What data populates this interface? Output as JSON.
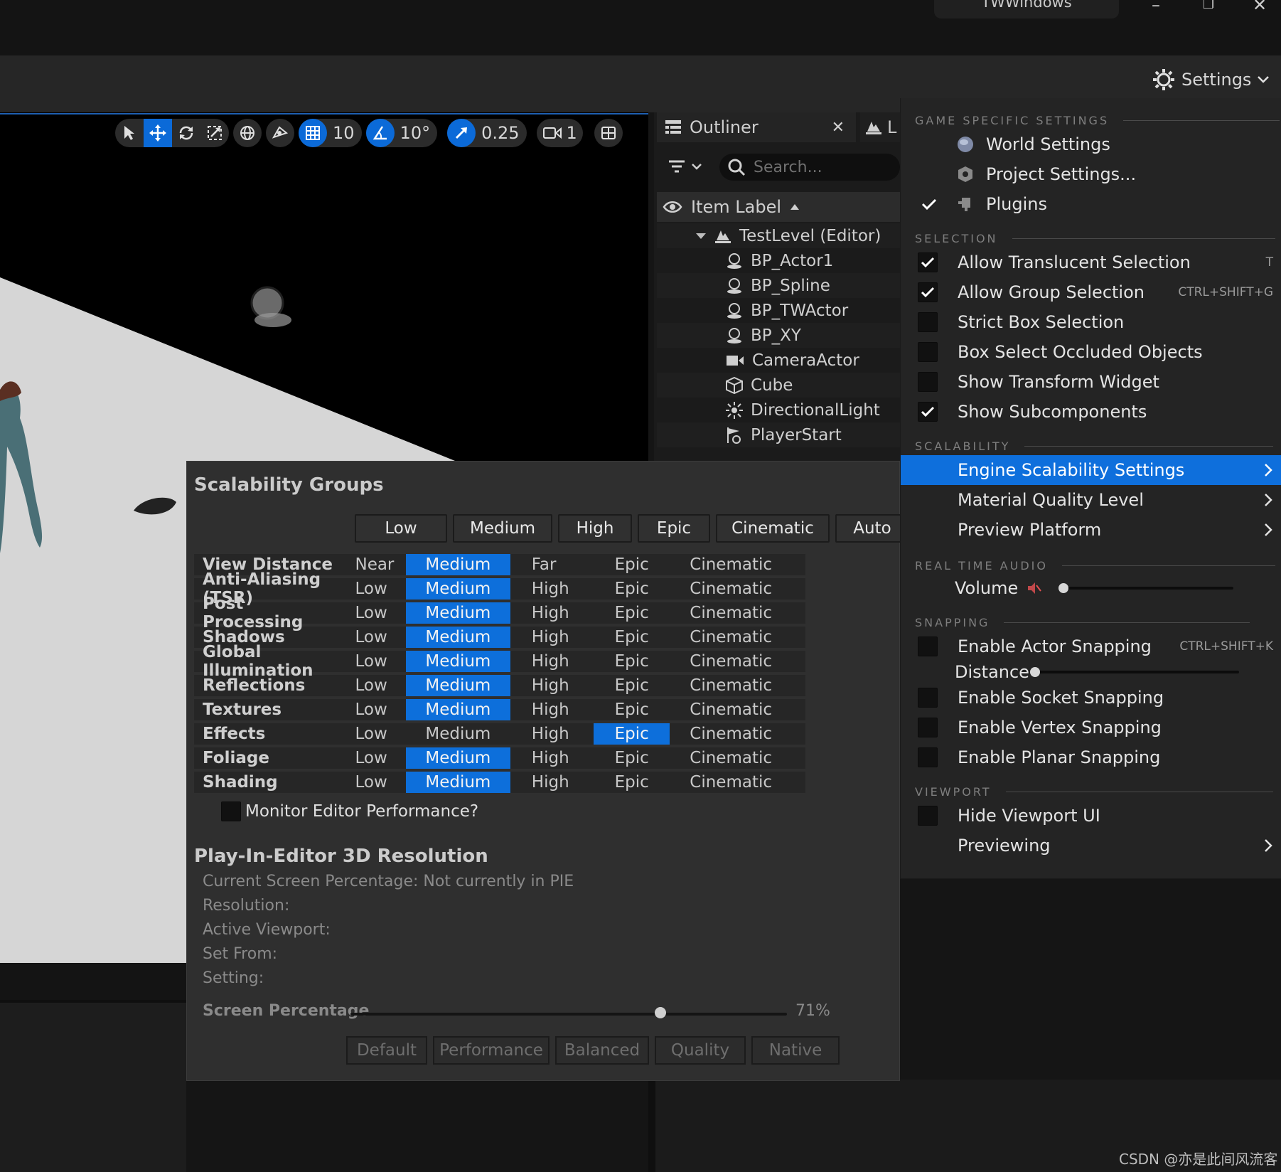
{
  "window": {
    "tab_title": "TWWindows",
    "minimize": "–",
    "restore": "❐",
    "close": "✕"
  },
  "settings_button": {
    "label": "Settings"
  },
  "viewport_toolbar": {
    "grid_snap_value": "10",
    "rotation_snap_value": "10°",
    "scale_snap_value": "0.25",
    "camera_speed_value": "1"
  },
  "outliner": {
    "tab_label": "Outliner",
    "second_tab_label": "L",
    "search_placeholder": "Search...",
    "column_header": "Item Label",
    "level": "TestLevel (Editor)",
    "items": [
      {
        "label": "BP_Actor1",
        "icon": "actor-icon"
      },
      {
        "label": "BP_Spline",
        "icon": "actor-icon"
      },
      {
        "label": "BP_TWActor",
        "icon": "actor-icon"
      },
      {
        "label": "BP_XY",
        "icon": "actor-icon"
      },
      {
        "label": "CameraActor",
        "icon": "camera-icon"
      },
      {
        "label": "Cube",
        "icon": "cube-icon"
      },
      {
        "label": "DirectionalLight",
        "icon": "sun-icon"
      },
      {
        "label": "PlayerStart",
        "icon": "flag-icon"
      }
    ]
  },
  "scalability": {
    "title": "Scalability Groups",
    "levels": [
      "Low",
      "Medium",
      "High",
      "Epic",
      "Cinematic",
      "Auto"
    ],
    "groups": [
      {
        "name": "View Distance",
        "cols": [
          "Near",
          "Medium",
          "Far",
          "Epic",
          "Cinematic"
        ],
        "selected": 1
      },
      {
        "name": "Anti-Aliasing (TSR)",
        "cols": [
          "Low",
          "Medium",
          "High",
          "Epic",
          "Cinematic"
        ],
        "selected": 1
      },
      {
        "name": "Post Processing",
        "cols": [
          "Low",
          "Medium",
          "High",
          "Epic",
          "Cinematic"
        ],
        "selected": 1
      },
      {
        "name": "Shadows",
        "cols": [
          "Low",
          "Medium",
          "High",
          "Epic",
          "Cinematic"
        ],
        "selected": 1
      },
      {
        "name": "Global Illumination",
        "cols": [
          "Low",
          "Medium",
          "High",
          "Epic",
          "Cinematic"
        ],
        "selected": 1
      },
      {
        "name": "Reflections",
        "cols": [
          "Low",
          "Medium",
          "High",
          "Epic",
          "Cinematic"
        ],
        "selected": 1
      },
      {
        "name": "Textures",
        "cols": [
          "Low",
          "Medium",
          "High",
          "Epic",
          "Cinematic"
        ],
        "selected": 1
      },
      {
        "name": "Effects",
        "cols": [
          "Low",
          "Medium",
          "High",
          "Epic",
          "Cinematic"
        ],
        "selected": 3
      },
      {
        "name": "Foliage",
        "cols": [
          "Low",
          "Medium",
          "High",
          "Epic",
          "Cinematic"
        ],
        "selected": 1
      },
      {
        "name": "Shading",
        "cols": [
          "Low",
          "Medium",
          "High",
          "Epic",
          "Cinematic"
        ],
        "selected": 1
      }
    ],
    "monitor_label": "Monitor Editor Performance?",
    "pie_title": "Play-In-Editor 3D Resolution",
    "pie_lines": [
      "Current Screen Percentage: Not currently in PIE",
      "Resolution:",
      "Active Viewport:",
      "Set From:",
      "Setting:"
    ],
    "screen_percentage_label": "Screen Percentage",
    "screen_percentage_value": "71%",
    "screen_percentage_fraction": 0.71,
    "presets": [
      "Default",
      "Performance",
      "Balanced",
      "Quality",
      "Native"
    ]
  },
  "menu": {
    "sections": {
      "game": "GAME SPECIFIC SETTINGS",
      "selection": "SELECTION",
      "scalability": "SCALABILITY",
      "audio": "REAL TIME AUDIO",
      "snapping": "SNAPPING",
      "viewport": "VIEWPORT"
    },
    "world_settings": "World Settings",
    "project_settings": "Project Settings...",
    "plugins": "Plugins",
    "allow_translucent": {
      "label": "Allow Translucent Selection",
      "shortcut": "T",
      "checked": true
    },
    "allow_group": {
      "label": "Allow Group Selection",
      "shortcut": "CTRL+SHIFT+G",
      "checked": true
    },
    "strict_box": {
      "label": "Strict Box Selection",
      "checked": false
    },
    "box_occluded": {
      "label": "Box Select Occluded Objects",
      "checked": false
    },
    "show_transform": {
      "label": "Show Transform Widget",
      "checked": false
    },
    "show_subcomponents": {
      "label": "Show Subcomponents",
      "checked": true
    },
    "engine_scalability": "Engine Scalability Settings",
    "material_quality": "Material Quality Level",
    "preview_platform": "Preview Platform",
    "volume": {
      "label": "Volume",
      "level": 0.0
    },
    "actor_snapping": {
      "label": "Enable Actor Snapping",
      "shortcut": "CTRL+SHIFT+K",
      "checked": false
    },
    "distance": {
      "label": "Distance",
      "level": 0.0
    },
    "socket_snapping": {
      "label": "Enable Socket Snapping",
      "checked": false
    },
    "vertex_snapping": {
      "label": "Enable Vertex Snapping",
      "checked": false
    },
    "planar_snapping": {
      "label": "Enable Planar Snapping",
      "checked": false
    },
    "hide_viewport_ui": {
      "label": "Hide Viewport UI",
      "checked": false
    },
    "previewing": "Previewing"
  },
  "watermark": "CSDN @亦是此间风流客",
  "colors": {
    "accent": "#0d6fdb",
    "panel": "#2f2f2f",
    "menu": "#242424"
  }
}
